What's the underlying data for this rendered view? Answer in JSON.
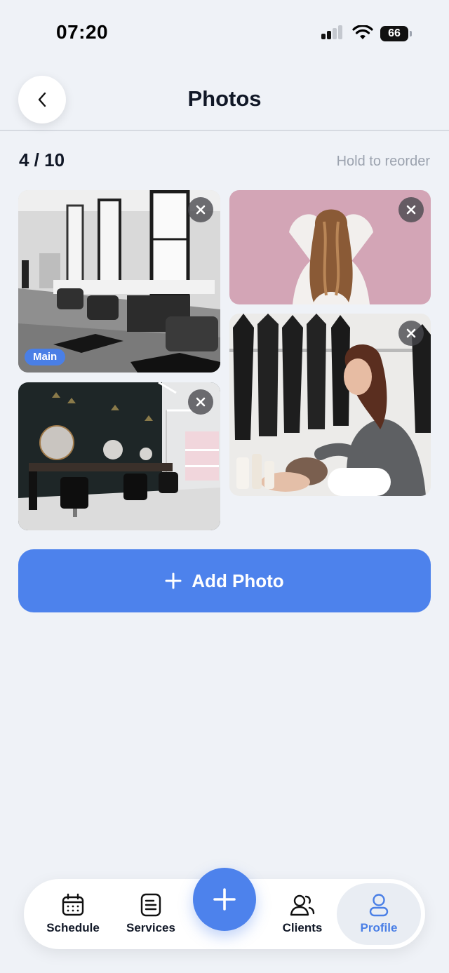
{
  "status_bar": {
    "time": "07:20",
    "battery": "66"
  },
  "header": {
    "title": "Photos"
  },
  "gallery": {
    "count": "4 / 10",
    "hint": "Hold to reorder",
    "main_badge": "Main"
  },
  "photos": [
    {
      "description": "salon-interior-bw",
      "is_main": true
    },
    {
      "description": "woman-hair-pink-wall",
      "is_main": false
    },
    {
      "description": "salon-interior-mirrors",
      "is_main": false
    },
    {
      "description": "stylist-washing-hair",
      "is_main": false
    }
  ],
  "actions": {
    "add_photo": "Add Photo"
  },
  "nav": {
    "items": [
      {
        "label": "Schedule",
        "icon": "calendar-icon"
      },
      {
        "label": "Services",
        "icon": "list-icon"
      },
      {
        "label": "Clients",
        "icon": "users-icon"
      },
      {
        "label": "Profile",
        "icon": "person-icon",
        "active": true
      }
    ]
  },
  "colors": {
    "accent": "#4d82ec",
    "background": "#eff2f7"
  }
}
